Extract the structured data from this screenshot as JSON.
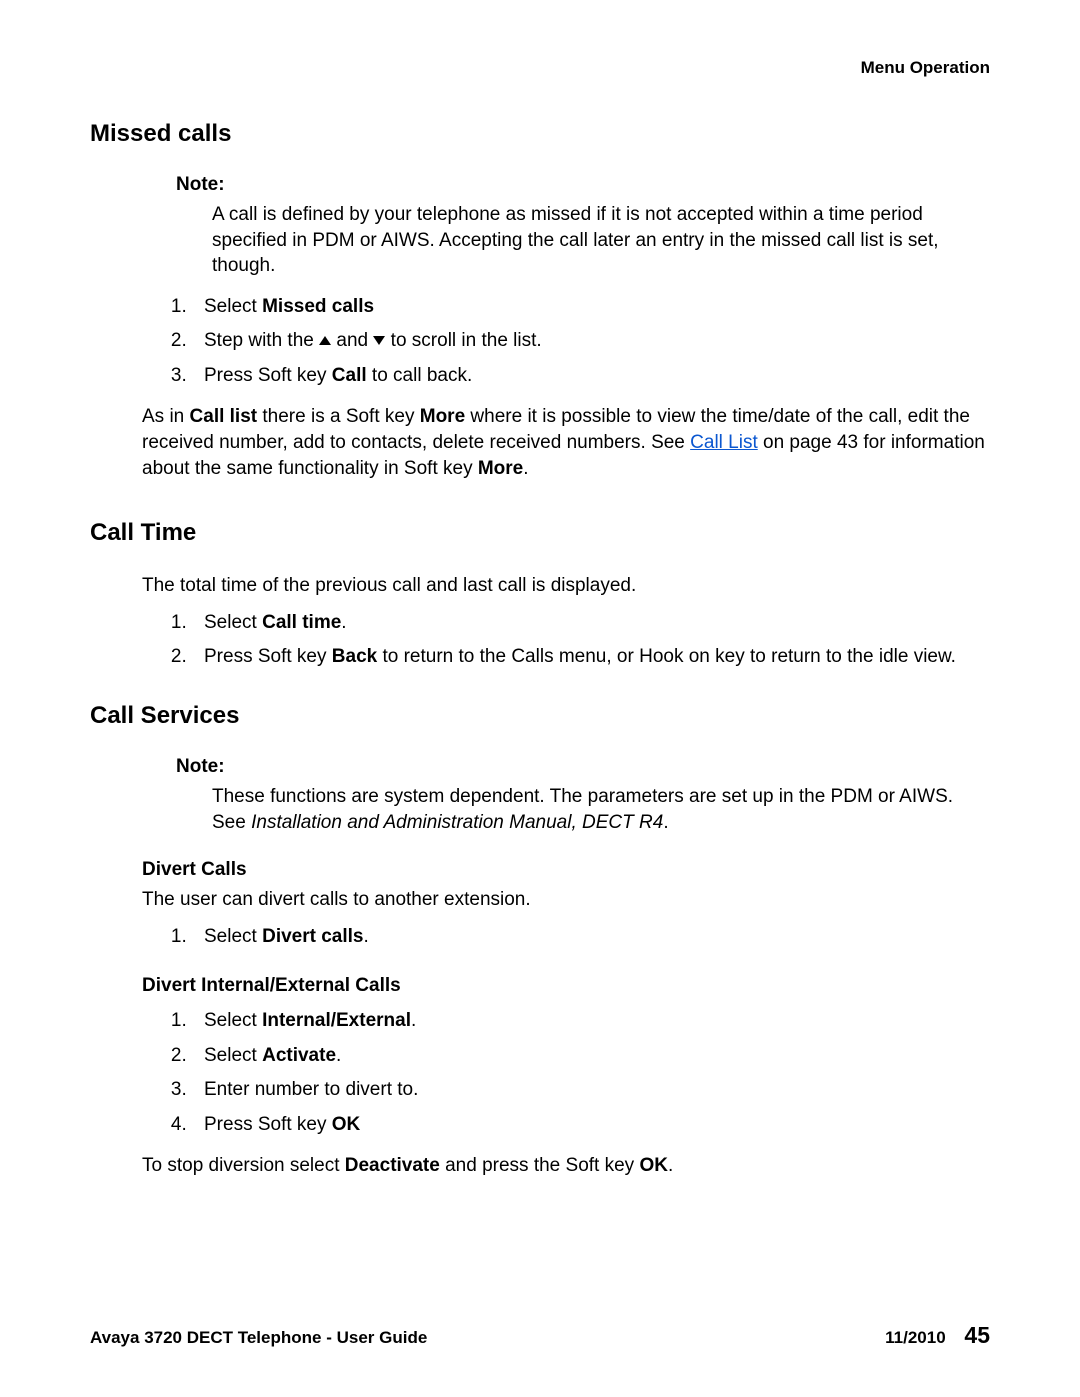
{
  "header": {
    "breadcrumb": "Menu Operation"
  },
  "sections": {
    "missed_calls": {
      "heading": "Missed calls",
      "note_label": "Note:",
      "note_body": "A call is defined by your telephone as missed if it is not accepted within a time period specified in PDM or AIWS. Accepting the call later an entry in the missed call list is set, though.",
      "steps": {
        "s1_pre": "Select ",
        "s1_bold": "Missed calls",
        "s2_pre": "Step with the ",
        "s2_mid": " and ",
        "s2_post": " to scroll in the list.",
        "s3_pre": "Press Soft key ",
        "s3_bold": "Call",
        "s3_post": " to call back."
      },
      "para_pre": "As in ",
      "para_b1": "Call list",
      "para_mid1": " there is a Soft key ",
      "para_b2": "More",
      "para_mid2": " where it is possible to view the time/date of the call, edit the received number, add to contacts, delete received numbers. See ",
      "para_link": "Call List",
      "para_mid3": " on page 43 for information about the same functionality in Soft key ",
      "para_b3": "More",
      "para_end": "."
    },
    "call_time": {
      "heading": "Call Time",
      "intro": "The total time of the previous call and last call is displayed.",
      "steps": {
        "s1_pre": "Select ",
        "s1_bold": "Call time",
        "s1_post": ".",
        "s2_pre": "Press Soft key ",
        "s2_bold": "Back",
        "s2_post": " to return to the Calls menu, or Hook on key to return to the idle view."
      }
    },
    "call_services": {
      "heading": "Call Services",
      "note_label": "Note:",
      "note_body_pre": "These functions are system dependent. The parameters are set up in the PDM or AIWS. See ",
      "note_body_italic": "Installation and Administration Manual, DECT R4",
      "note_body_post": ".",
      "divert_calls": {
        "heading": "Divert Calls",
        "intro": "The user can divert calls to another extension.",
        "s1_pre": "Select ",
        "s1_bold": "Divert calls",
        "s1_post": "."
      },
      "divert_ie": {
        "heading": "Divert Internal/External Calls",
        "s1_pre": "Select ",
        "s1_bold": "Internal/External",
        "s1_post": ".",
        "s2_pre": "Select ",
        "s2_bold": "Activate",
        "s2_post": ".",
        "s3": "Enter number to divert to.",
        "s4_pre": "Press Soft key ",
        "s4_bold": "OK",
        "stop_pre": "To stop diversion select ",
        "stop_b1": "Deactivate",
        "stop_mid": " and press the Soft key ",
        "stop_b2": "OK",
        "stop_post": "."
      }
    }
  },
  "footer": {
    "left": "Avaya 3720 DECT Telephone - User Guide",
    "date": "11/2010",
    "page": "45"
  }
}
